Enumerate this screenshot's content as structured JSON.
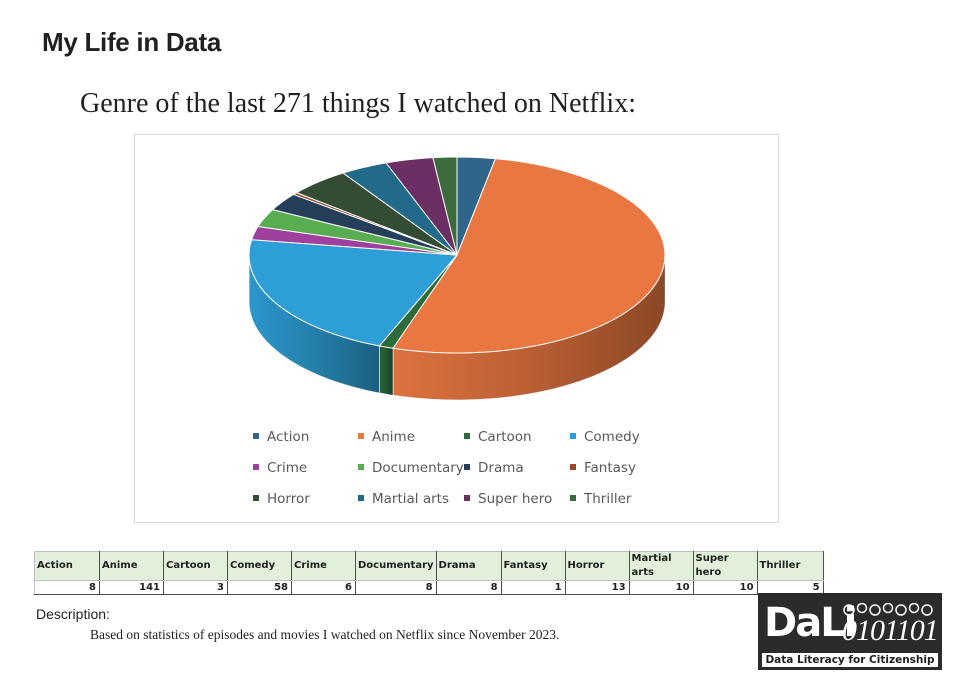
{
  "page": {
    "title": "My Life in Data",
    "chart_heading": "Genre of the last 271 things I watched on Netflix:",
    "description_label": "Description:",
    "description_text": "Based on statistics of episodes and movies  I watched on Netflix since November 2023."
  },
  "logo": {
    "main": "DaLi",
    "binary": "0101101",
    "tagline": "Data Literacy for Citizenship"
  },
  "chart_data": {
    "type": "pie",
    "title": "Genre of the last 271 things I watched on Netflix:",
    "total": 271,
    "style": "3d",
    "legend_position": "bottom",
    "categories": [
      "Action",
      "Anime",
      "Cartoon",
      "Comedy",
      "Crime",
      "Documentary",
      "Drama",
      "Fantasy",
      "Horror",
      "Martial arts",
      "Super hero",
      "Thriller"
    ],
    "values": [
      8,
      141,
      3,
      58,
      6,
      8,
      8,
      1,
      13,
      10,
      10,
      5
    ],
    "colors": [
      "#2e6589",
      "#e97741",
      "#2d6b3b",
      "#2e9fd6",
      "#a0409e",
      "#57ad4f",
      "#253f5a",
      "#9a4a2a",
      "#334c33",
      "#226a8a",
      "#6b2f63",
      "#3c6b3d"
    ]
  },
  "table": {
    "headers": [
      "Action",
      "Anime",
      "Cartoon",
      "Comedy",
      "Crime",
      "Documentary",
      "Drama",
      "Fantasy",
      "Horror",
      "Martial arts",
      "Super hero",
      "Thriller"
    ],
    "values": [
      "8",
      "141",
      "3",
      "58",
      "6",
      "8",
      "8",
      "1",
      "13",
      "10",
      "10",
      "5"
    ]
  }
}
